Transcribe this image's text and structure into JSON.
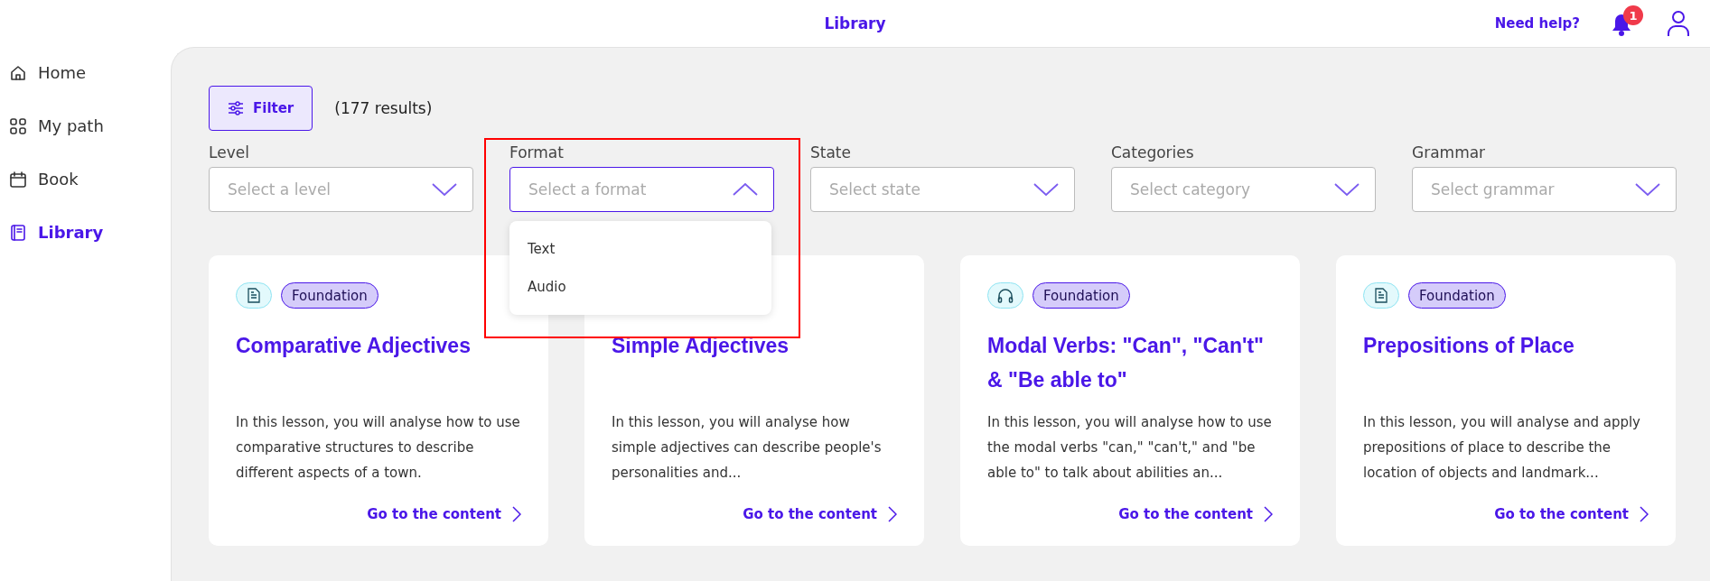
{
  "header": {
    "title": "Library",
    "help_link": "Need help?",
    "notification_count": "1"
  },
  "sidebar": {
    "items": [
      {
        "label": "Home",
        "kind": "home",
        "selected": false
      },
      {
        "label": "My path",
        "kind": "grid",
        "selected": false
      },
      {
        "label": "Book",
        "kind": "calendar",
        "selected": false
      },
      {
        "label": "Library",
        "kind": "book",
        "selected": true
      }
    ]
  },
  "toolbar": {
    "filter_button": "Filter",
    "results": "(177 results)"
  },
  "filters": [
    {
      "label": "Level",
      "placeholder": "Select a level",
      "expanded": false,
      "highlighted": false
    },
    {
      "label": "Format",
      "placeholder": "Select a format",
      "expanded": true,
      "highlighted": true,
      "options": [
        "Text",
        "Audio"
      ]
    },
    {
      "label": "State",
      "placeholder": "Select state",
      "expanded": false,
      "highlighted": false
    },
    {
      "label": "Categories",
      "placeholder": "Select category",
      "expanded": false,
      "highlighted": false
    },
    {
      "label": "Grammar",
      "placeholder": "Select grammar",
      "expanded": false,
      "highlighted": false
    }
  ],
  "cards": [
    {
      "kind": "text",
      "tag": "Foundation",
      "title": "Comparative Adjectives",
      "description": "In this lesson, you will analyse how to use comparative structures to describe different aspects of a town.",
      "link": "Go to the content"
    },
    {
      "title": "Simple Adjectives",
      "description": "In this lesson, you will analyse how simple adjectives can describe people's personalities and...",
      "link": "Go to the content"
    },
    {
      "kind": "audio",
      "tag": "Foundation",
      "title": "Modal Verbs: \"Can\", \"Can't\" & \"Be able to\"",
      "description": "In this lesson, you will analyse how to use the modal verbs \"can,\" \"can't,\" and \"be able to\" to talk about abilities an...",
      "link": "Go to the content"
    },
    {
      "kind": "text",
      "tag": "Foundation",
      "title": "Prepositions of Place",
      "description": "In this lesson, you will analyse and apply prepositions of place to describe the location of objects and landmark...",
      "link": "Go to the content"
    }
  ]
}
